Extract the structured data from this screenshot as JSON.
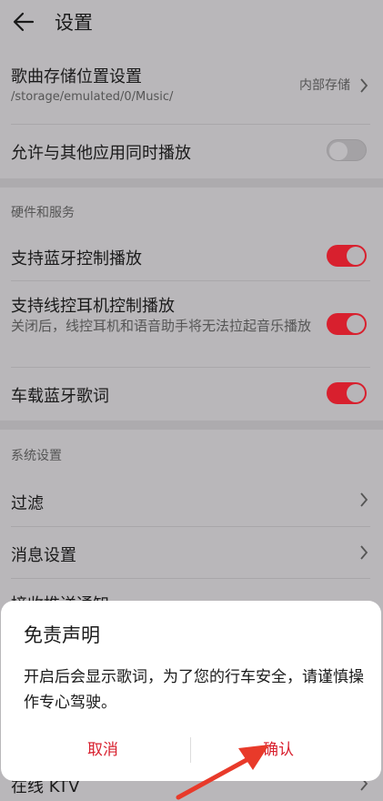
{
  "header": {
    "title": "设置"
  },
  "rows": {
    "storage": {
      "title": "歌曲存储位置设置",
      "sub": "/storage/emulated/0/Music/",
      "value": "内部存储"
    },
    "mix": {
      "title": "允许与其他应用同时播放",
      "toggle": false
    }
  },
  "hardware": {
    "heading": "硬件和服务",
    "bt": {
      "title": "支持蓝牙控制播放",
      "toggle": true
    },
    "wired": {
      "title": "支持线控耳机控制播放",
      "sub": "关闭后，线控耳机和语音助手将无法拉起音乐播放",
      "toggle": true
    },
    "car": {
      "title": "车载蓝牙歌词",
      "toggle": true
    }
  },
  "system": {
    "heading": "系统设置",
    "filter": {
      "title": "过滤"
    },
    "message": {
      "title": "消息设置"
    },
    "push": {
      "title": "接收推送通知"
    },
    "ktv": {
      "title": "在线 KTV"
    }
  },
  "dialog": {
    "title": "免责声明",
    "message": "开启后会显示歌词，为了您的行车安全，请谨慎操作专心驾驶。",
    "cancel": "取消",
    "confirm": "确认"
  },
  "colors": {
    "accent": "#d8202e",
    "background": "#b9b7ba",
    "annotation_arrow": "#e83a2a"
  }
}
